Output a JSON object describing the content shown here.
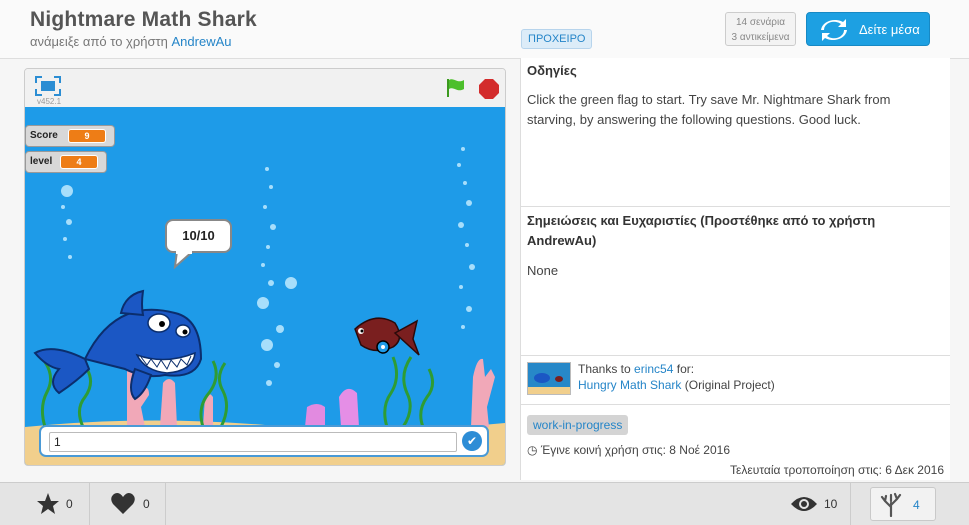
{
  "header": {
    "title": "Nightmare Math Shark",
    "subtitle_prefix": "ανάμειξε από το χρήστη",
    "author": "AndrewAu",
    "draft_badge": "ΠΡΟΧΕΙΡΟ",
    "stats_scripts": "14 σενάρια",
    "stats_sprites": "3 αντικείμενα",
    "see_inside_label": "Δείτε μέσα"
  },
  "player": {
    "version": "v452.1",
    "monitors": [
      {
        "label": "Score",
        "value": "9"
      },
      {
        "label": "level",
        "value": "4"
      }
    ],
    "speech_bubble": "10/10",
    "answer_value": "1"
  },
  "instructions": {
    "heading": "Οδηγίες",
    "text": "Click the green flag to start. Try save Mr. Nightmare Shark from starving, by answering the following questions. Good luck."
  },
  "notes": {
    "heading": "Σημειώσεις και Ευχαριστίες (Προστέθηκε από το χρήστη AndrewAu)",
    "text": "None"
  },
  "credits": {
    "thanks_prefix": "Thanks to",
    "user": "erinc54",
    "for_label": "for:",
    "project": "Hungry Math Shark",
    "project_suffix": "(Original Project)"
  },
  "meta": {
    "tag": "work-in-progress",
    "shared": "Έγινε κοινή χρήση στις: 8 Νοέ 2016",
    "modified": "Τελευταία τροποποίηση στις: 6 Δεκ 2016"
  },
  "footer": {
    "favorites": "0",
    "loves": "0",
    "views": "10",
    "remixes": "4"
  },
  "colors": {
    "accent": "#1da0e2",
    "stage_water": "#1e9be8",
    "monitor_value": "#ee7d16",
    "flag": "#4cbf2b",
    "stop": "#d32c2c"
  }
}
